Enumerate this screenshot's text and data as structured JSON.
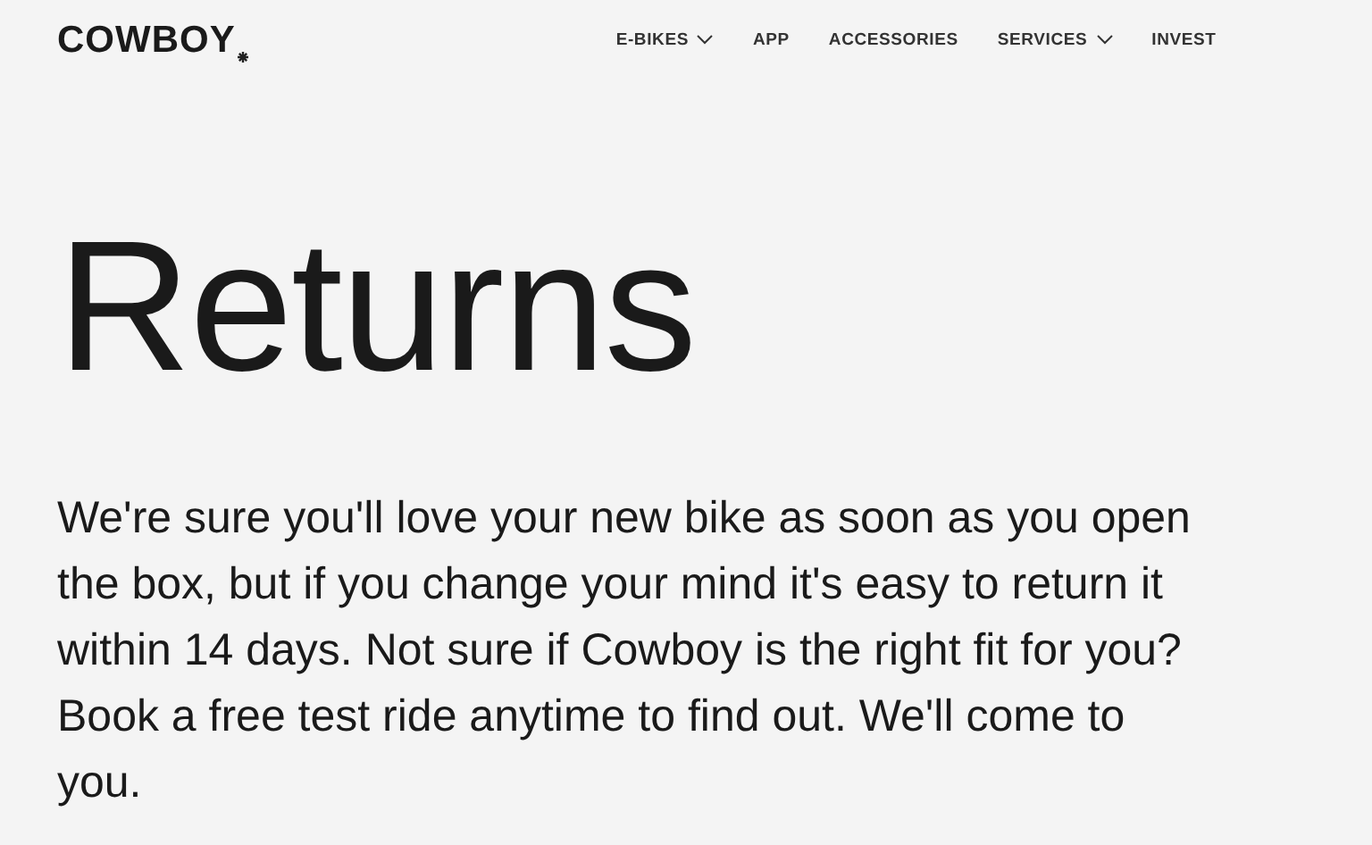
{
  "header": {
    "logo": "COWBOY",
    "nav": [
      {
        "label": "E-BIKES",
        "has_menu": true
      },
      {
        "label": "APP",
        "has_menu": false
      },
      {
        "label": "ACCESSORIES",
        "has_menu": false
      },
      {
        "label": "SERVICES",
        "has_menu": true
      },
      {
        "label": "INVEST",
        "has_menu": false
      }
    ]
  },
  "title": "Returns",
  "intro": "We're sure you'll love your new bike as soon as you open the box, but if you change your mind it's easy to return it within 14 days. Not sure if Cowboy is the right fit for you? Book a free test ride anytime to find out. We'll come to you."
}
